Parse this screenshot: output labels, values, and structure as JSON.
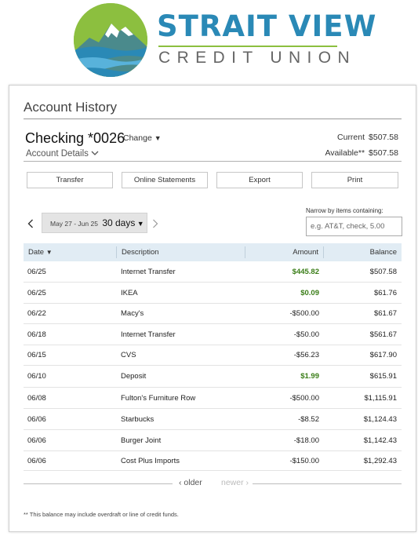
{
  "brand": {
    "line1": "STRAIT VIEW",
    "line2": "CREDIT UNION",
    "primary_color": "#2a89b6",
    "accent_color": "#8cbf3f"
  },
  "page": {
    "title": "Account History"
  },
  "account": {
    "name": "Checking *0026",
    "change_label": "Change",
    "details_label": "Account Details",
    "current_label": "Current",
    "current_value": "$507.58",
    "available_label": "Available**",
    "available_value": "$507.58"
  },
  "actions": {
    "transfer": "Transfer",
    "statements": "Online Statements",
    "export": "Export",
    "print": "Print"
  },
  "range": {
    "dates": "May 27 - Jun 25",
    "days": "30 days",
    "prev_icon": "chevron-left-icon",
    "next_icon": "chevron-right-icon"
  },
  "filter": {
    "label": "Narrow by items containing:",
    "placeholder": "e.g. AT&T, check, 5.00",
    "value": ""
  },
  "table": {
    "headers": {
      "date": "Date",
      "description": "Description",
      "amount": "Amount",
      "balance": "Balance"
    },
    "rows": [
      {
        "date": "06/25",
        "description": "Internet Transfer",
        "amount": "$445.82",
        "balance": "$507.58",
        "credit": true
      },
      {
        "date": "06/25",
        "description": "IKEA",
        "amount": "$0.09",
        "balance": "$61.76",
        "credit": true
      },
      {
        "date": "06/22",
        "description": "Macy's",
        "amount": "-$500.00",
        "balance": "$61.67",
        "credit": false
      },
      {
        "date": "06/18",
        "description": "Internet Transfer",
        "amount": "-$50.00",
        "balance": "$561.67",
        "credit": false
      },
      {
        "date": "06/15",
        "description": "CVS",
        "amount": "-$56.23",
        "balance": "$617.90",
        "credit": false
      },
      {
        "date": "06/10",
        "description": "Deposit",
        "amount": "$1.99",
        "balance": "$615.91",
        "credit": true
      },
      {
        "date": "06/08",
        "description": "Fulton's Furniture Row",
        "amount": "-$500.00",
        "balance": "$1,115.91",
        "credit": false
      },
      {
        "date": "06/06",
        "description": "Starbucks",
        "amount": "-$8.52",
        "balance": "$1,124.43",
        "credit": false
      },
      {
        "date": "06/06",
        "description": "Burger Joint",
        "amount": "-$18.00",
        "balance": "$1,142.43",
        "credit": false
      },
      {
        "date": "06/06",
        "description": "Cost Plus Imports",
        "amount": "-$150.00",
        "balance": "$1,292.43",
        "credit": false
      }
    ]
  },
  "pager": {
    "older": "older",
    "newer": "newer"
  },
  "footnote": "** This balance may include overdraft or line of credit funds."
}
